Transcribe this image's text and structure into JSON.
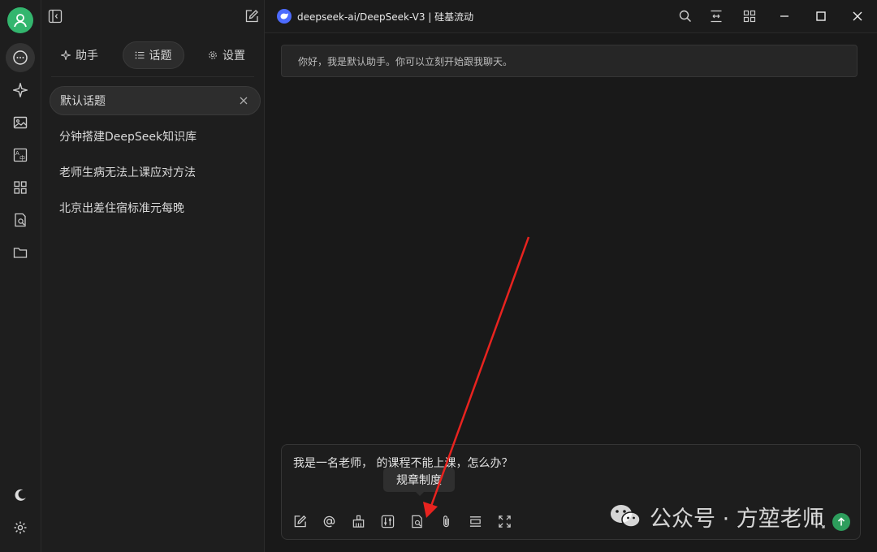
{
  "window": {
    "title": "deepseek-ai/DeepSeek-V3 | 硅基流动"
  },
  "sidebar": {
    "tabs": [
      {
        "label": "助手",
        "icon": "sparkle-icon"
      },
      {
        "label": "话题",
        "icon": "list-icon",
        "active": true
      },
      {
        "label": "设置",
        "icon": "gear-icon"
      }
    ],
    "topics": [
      {
        "label": "默认话题",
        "active": true
      },
      {
        "label": "分钟搭建DeepSeek知识库"
      },
      {
        "label": "老师生病无法上课应对方法"
      },
      {
        "label": "北京出差住宿标准元每晚"
      }
    ]
  },
  "chat": {
    "welcome": "你好，我是默认助手。你可以立刻开始跟我聊天。"
  },
  "input": {
    "value": "我是一名老师，                        的课程不能上课，怎么办？",
    "tooltip": "规章制度"
  },
  "watermark": {
    "text": "公众号 · 方堃老师"
  },
  "colors": {
    "accent": "#33b66e",
    "send": "#2d9d5c",
    "annotation_arrow": "#e8231f",
    "model_badge": "#4d6bfe"
  }
}
